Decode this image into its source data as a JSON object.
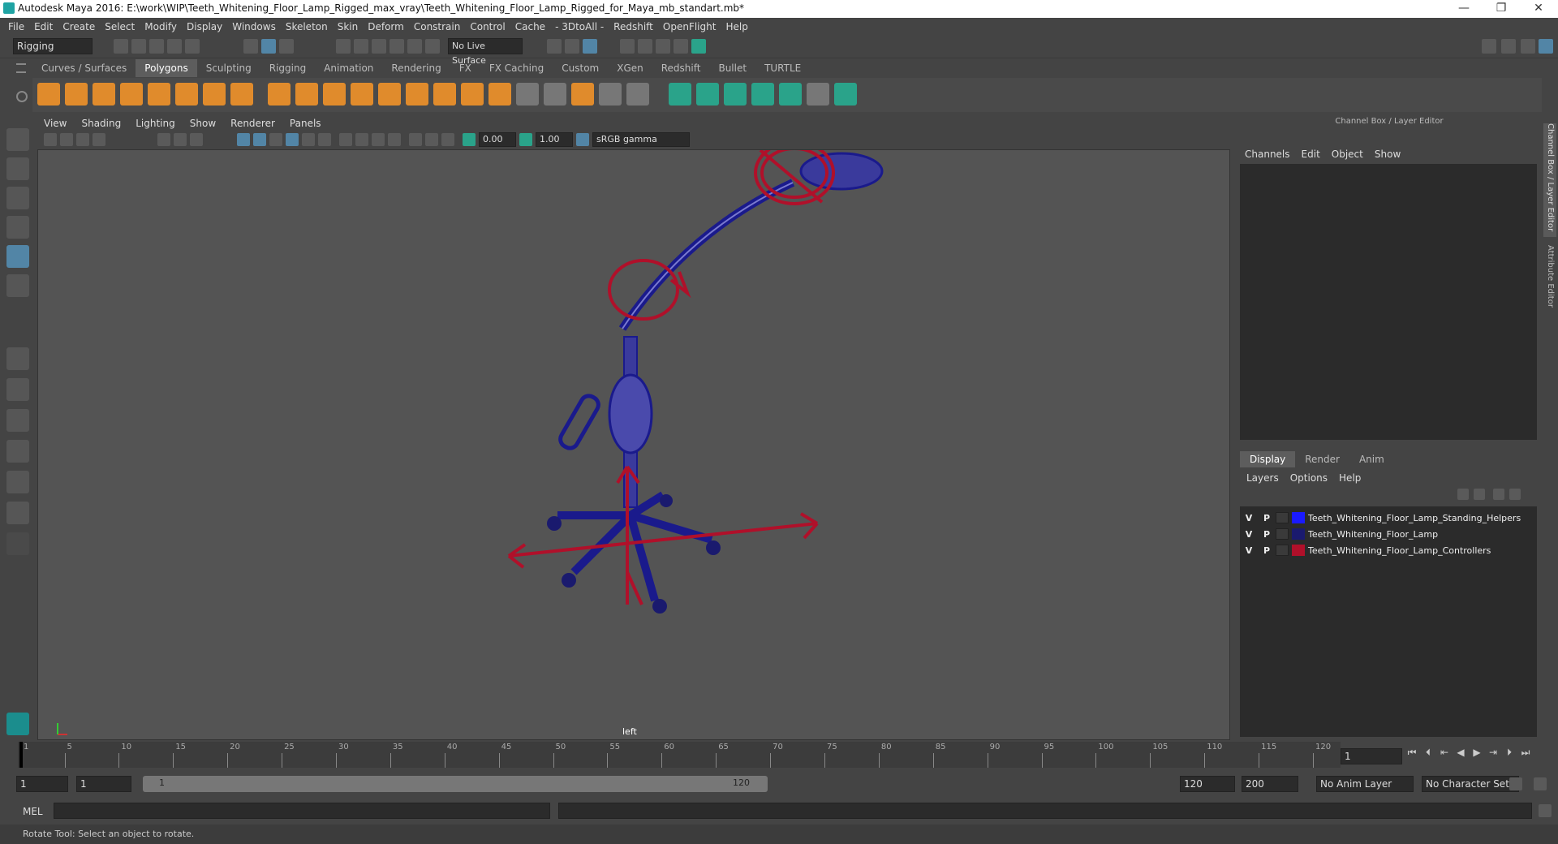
{
  "window": {
    "title": "Autodesk Maya 2016: E:\\work\\WIP\\Teeth_Whitening_Floor_Lamp_Rigged_max_vray\\Teeth_Whitening_Floor_Lamp_Rigged_for_Maya_mb_standart.mb*",
    "minimize": "—",
    "maximize": "❐",
    "close": "✕"
  },
  "menubar": [
    "File",
    "Edit",
    "Create",
    "Select",
    "Modify",
    "Display",
    "Windows",
    "Skeleton",
    "Skin",
    "Deform",
    "Constrain",
    "Control",
    "Cache",
    "- 3DtoAll -",
    "Redshift",
    "OpenFlight",
    "Help"
  ],
  "statusline": {
    "menuset": "Rigging",
    "live_surface": "No Live Surface"
  },
  "shelf_tabs": [
    "Curves / Surfaces",
    "Polygons",
    "Sculpting",
    "Rigging",
    "Animation",
    "Rendering",
    "FX",
    "FX Caching",
    "Custom",
    "XGen",
    "Redshift",
    "Bullet",
    "TURTLE"
  ],
  "shelf_active": "Polygons",
  "viewport": {
    "menu": [
      "View",
      "Shading",
      "Lighting",
      "Show",
      "Renderer",
      "Panels"
    ],
    "field_exposure": "0.00",
    "field_gamma": "1.00",
    "color_space": "sRGB gamma",
    "camera_label": "left"
  },
  "channel_box": {
    "title": "Channel Box / Layer Editor",
    "menu": [
      "Channels",
      "Edit",
      "Object",
      "Show"
    ]
  },
  "layer_editor": {
    "tabs": [
      "Display",
      "Render",
      "Anim"
    ],
    "active_tab": "Display",
    "menu": [
      "Layers",
      "Options",
      "Help"
    ],
    "layers": [
      {
        "v": "V",
        "p": "P",
        "name": "Teeth_Whitening_Floor_Lamp_Standing_Helpers",
        "color": "#1a1aff"
      },
      {
        "v": "V",
        "p": "P",
        "name": "Teeth_Whitening_Floor_Lamp",
        "color": "#1a1a6e"
      },
      {
        "v": "V",
        "p": "P",
        "name": "Teeth_Whitening_Floor_Lamp_Controllers",
        "color": "#b0102a"
      }
    ]
  },
  "side_tabs": [
    "Channel Box / Layer Editor",
    "Attribute Editor"
  ],
  "timeline": {
    "ticks": [
      "1",
      "5",
      "10",
      "15",
      "20",
      "25",
      "30",
      "35",
      "40",
      "45",
      "50",
      "55",
      "60",
      "65",
      "70",
      "75",
      "80",
      "85",
      "90",
      "95",
      "100",
      "105",
      "110",
      "115",
      "120"
    ],
    "current_frame": "1"
  },
  "range": {
    "start": "1",
    "playback_start": "1",
    "slider_start": "1",
    "slider_end": "120",
    "playback_end": "120",
    "end": "200",
    "anim_layer": "No Anim Layer",
    "character_set": "No Character Set"
  },
  "command": {
    "label": "MEL"
  },
  "help_line": "Rotate Tool: Select an object to rotate.",
  "colors": {
    "mesh": "#1a1a8c",
    "controller": "#b0102a",
    "accent": "#5285a6"
  }
}
